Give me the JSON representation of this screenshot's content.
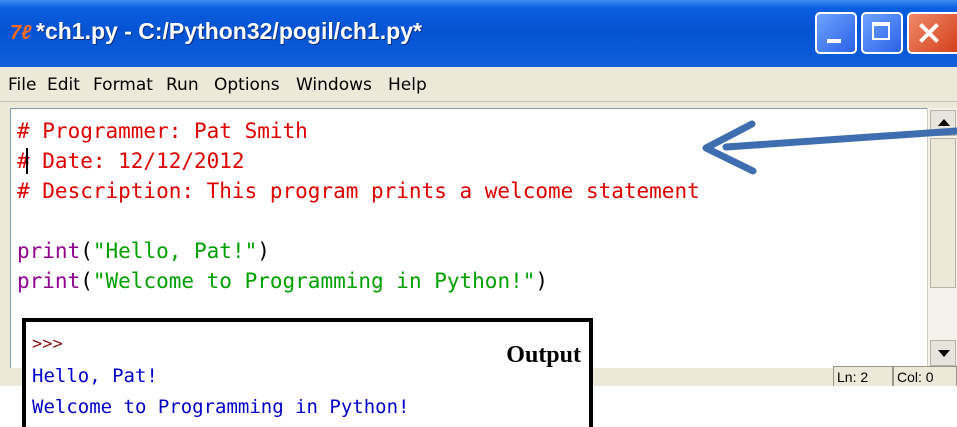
{
  "window": {
    "title": "*ch1.py - C:/Python32/pogil/ch1.py*",
    "app_icon": "7ℓ",
    "controls": [
      "minimize",
      "maximize",
      "close"
    ]
  },
  "menu": [
    "File",
    "Edit",
    "Format",
    "Run",
    "Options",
    "Windows",
    "Help"
  ],
  "editor": {
    "lines": [
      {
        "kind": "comment",
        "text": "# Programmer: Pat Smith"
      },
      {
        "kind": "comment",
        "text": "# Date: 12/12/2012"
      },
      {
        "kind": "comment",
        "text": "# Description: This program prints a welcome statement"
      },
      {
        "kind": "blank",
        "text": ""
      },
      {
        "kind": "code",
        "func": "print",
        "open": "(",
        "arg": "\"Hello, Pat!\"",
        "close": ")"
      },
      {
        "kind": "code",
        "func": "print",
        "open": "(",
        "arg": "\"Welcome to Programming in Python!\"",
        "close": ")"
      }
    ]
  },
  "status": {
    "line": "Ln: 2",
    "col": "Col: 0"
  },
  "output": {
    "label": "Output",
    "prompt": ">>>",
    "lines": [
      "Hello, Pat!",
      "Welcome to Programming in Python!"
    ]
  },
  "colors": {
    "comment": "#dd0000",
    "builtin": "#900090",
    "string": "#00a000",
    "stdout": "#0000c8",
    "arrow": "#3f6eb0",
    "titlebar": "#0553d3"
  },
  "icons": [
    "app-icon",
    "minimize-icon",
    "maximize-icon",
    "close-icon",
    "scroll-up-arrow-icon",
    "scroll-down-arrow-icon",
    "pointer-arrow-icon"
  ]
}
